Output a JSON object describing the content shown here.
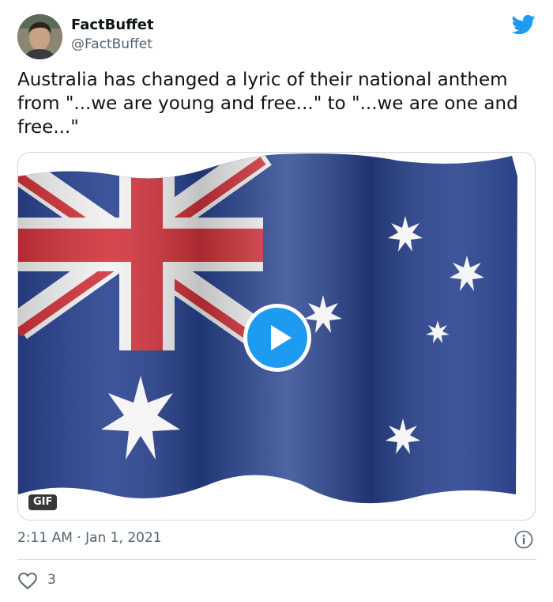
{
  "author": {
    "display_name": "FactBuffet",
    "handle": "@FactBuffet"
  },
  "tweet": {
    "text": "Australia has changed a lyric of their national anthem from \"...we are young and free...\" to \"...we are one and free...\"",
    "timestamp": "2:11 AM · Jan 1, 2021",
    "like_count": "3"
  },
  "media": {
    "badge": "GIF",
    "content": "waving-australian-flag",
    "play_icon": "play-icon"
  },
  "icons": {
    "brand": "twitter-bird-icon",
    "info": "info-icon",
    "like": "heart-icon"
  },
  "colors": {
    "accent": "#1d9bf0",
    "text": "#0f1419",
    "secondary_text": "#536471",
    "border": "#cfd9de",
    "flag_blue": "#28428f",
    "flag_red": "#d2333b"
  }
}
